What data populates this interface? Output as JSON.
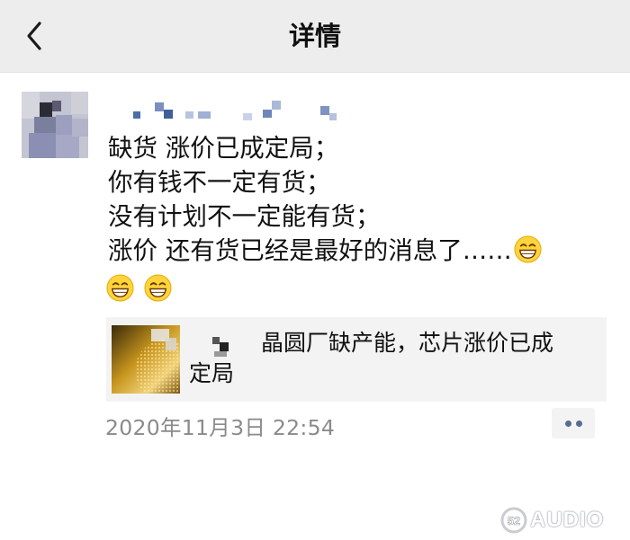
{
  "header": {
    "title": "详情"
  },
  "post": {
    "lines": [
      "缺货  涨价已成定局；",
      "你有钱不一定有货；",
      "没有计划不一定能有货；",
      "涨价 还有货已经是最好的消息了……"
    ],
    "emojis": [
      "grin-emoji",
      "grin-emoji",
      "grin-emoji"
    ],
    "link": {
      "title_line1": "晶圆厂缺产能，芯片涨价已成",
      "title_line2": "定局"
    },
    "time": "2020年11月3日 22:54"
  },
  "watermark": {
    "badge": "52",
    "text": "AUDIO"
  },
  "icons": {
    "back": "chevron-left-icon",
    "more": "more-dots-icon"
  },
  "colors": {
    "navbar_bg": "#ededed",
    "link_card_bg": "#f3f3f3",
    "time_text": "#8a8a8a",
    "more_dots": "#576b95"
  }
}
